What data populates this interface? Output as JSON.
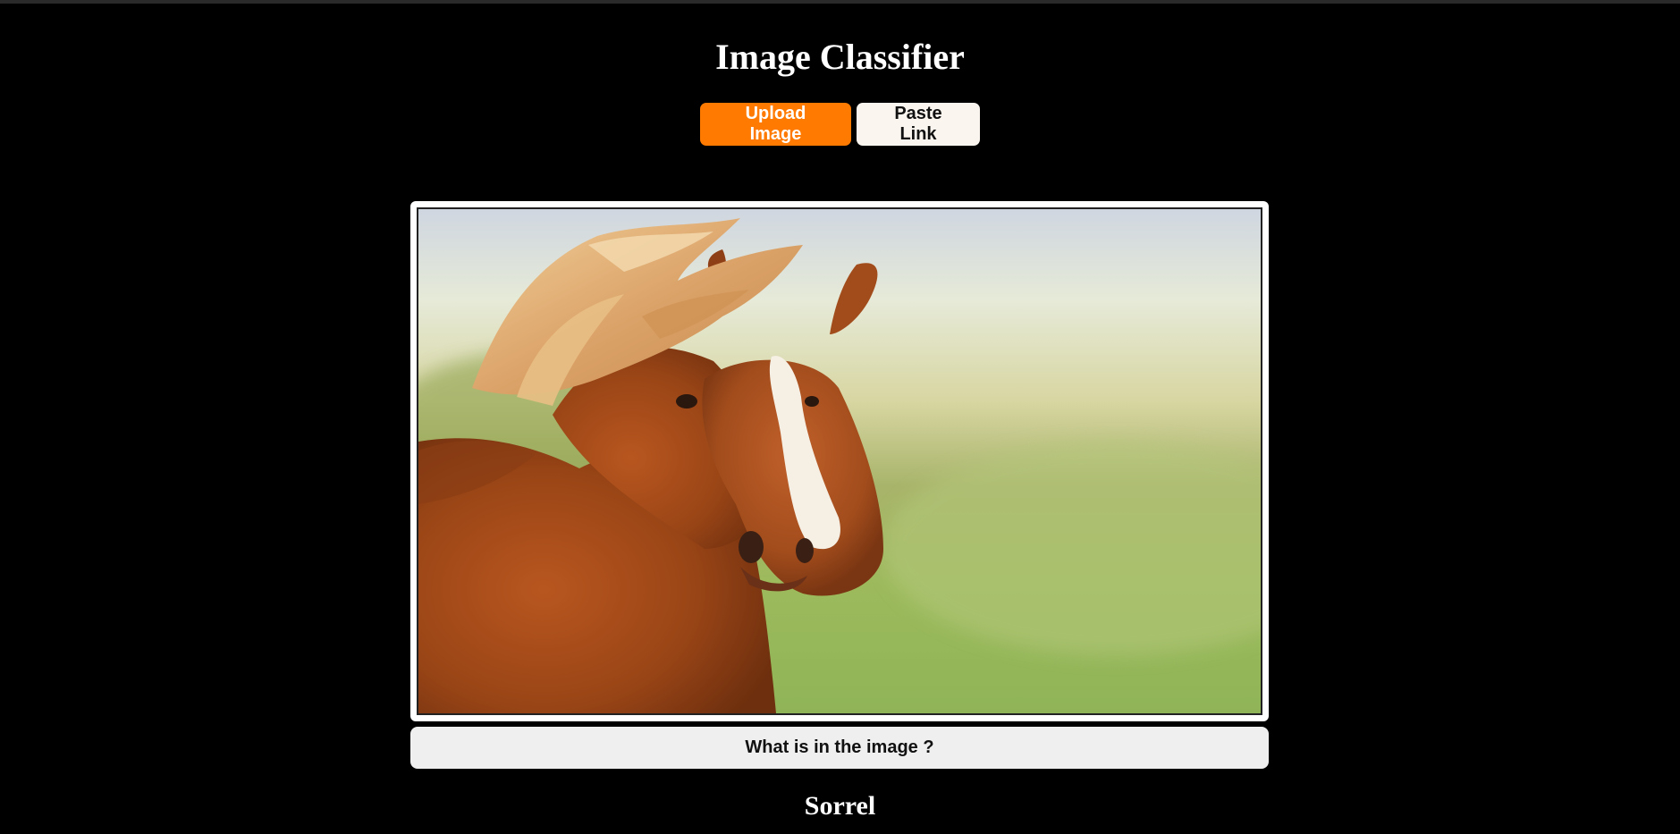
{
  "app": {
    "title": "Image Classifier"
  },
  "tabs": [
    {
      "label": "Upload Image",
      "active": true
    },
    {
      "label": "Paste Link",
      "active": false
    }
  ],
  "preview": {
    "content": "horse-photo"
  },
  "action": {
    "ask_label": "What is in the image ?"
  },
  "result": {
    "label": "Sorrel"
  },
  "colors": {
    "background": "#000000",
    "accent": "#ff7a00",
    "secondary_button": "#fbf5ef",
    "ask_button": "#efefef",
    "text_light": "#ffffff"
  }
}
